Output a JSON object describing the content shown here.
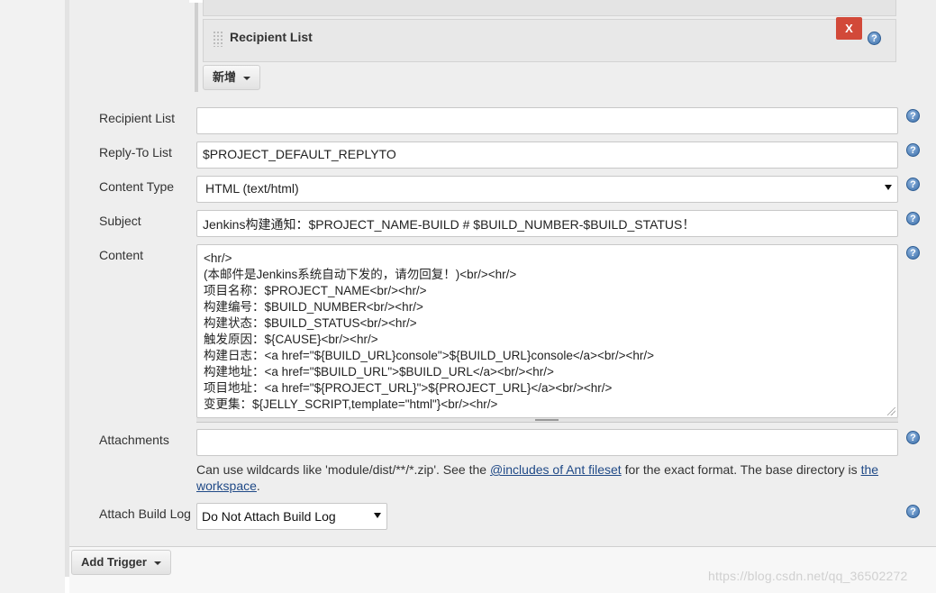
{
  "recipient_block": {
    "title": "Recipient List",
    "delete_label": "X",
    "add_label": "新增"
  },
  "form": {
    "recipient_list": {
      "label": "Recipient List",
      "value": ""
    },
    "reply_to": {
      "label": "Reply-To List",
      "value": "$PROJECT_DEFAULT_REPLYTO"
    },
    "content_type": {
      "label": "Content Type",
      "value": "HTML (text/html)"
    },
    "subject": {
      "label": "Subject",
      "value": "Jenkins构建通知：$PROJECT_NAME-BUILD # $BUILD_NUMBER-$BUILD_STATUS！"
    },
    "content": {
      "label": "Content",
      "lines": [
        "<hr/>",
        "(本邮件是Jenkins系统自动下发的，请勿回复！)<br/><hr/>",
        "项目名称：$PROJECT_NAME<br/><hr/>",
        "构建编号：$BUILD_NUMBER<br/><hr/>",
        "构建状态：$BUILD_STATUS<br/><hr/>",
        "触发原因：${CAUSE}<br/><hr/>",
        "构建日志：<a href=\"${BUILD_URL}console\">${BUILD_URL}console</a><br/><hr/>",
        "构建地址：<a href=\"$BUILD_URL\">$BUILD_URL</a><br/><hr/>",
        "项目地址：<a href=\"${PROJECT_URL}\">${PROJECT_URL}</a><br/><hr/>",
        "变更集：${JELLY_SCRIPT,template=\"html\"}<br/><hr/>"
      ]
    },
    "attachments": {
      "label": "Attachments",
      "value": "",
      "hint_before": "Can use wildcards like 'module/dist/**/*.zip'. See the ",
      "hint_link": "@includes of Ant fileset",
      "hint_middle": " for the exact format. The base directory is ",
      "hint_link2": "the workspace",
      "hint_after": "."
    },
    "attach_build_log": {
      "label": "Attach Build Log",
      "value": "Do Not Attach Build Log"
    }
  },
  "add_trigger_label": "Add Trigger",
  "help_glyph": "?",
  "watermark": "https://blog.csdn.net/qq_36502272",
  "icons": [
    "help-icon",
    "drag-handle-icon",
    "caret-down-icon",
    "resize-grip-icon"
  ],
  "colors": {
    "delete_button": "#d24939",
    "help_icon": "#3b6ea8",
    "link": "#204a87"
  }
}
